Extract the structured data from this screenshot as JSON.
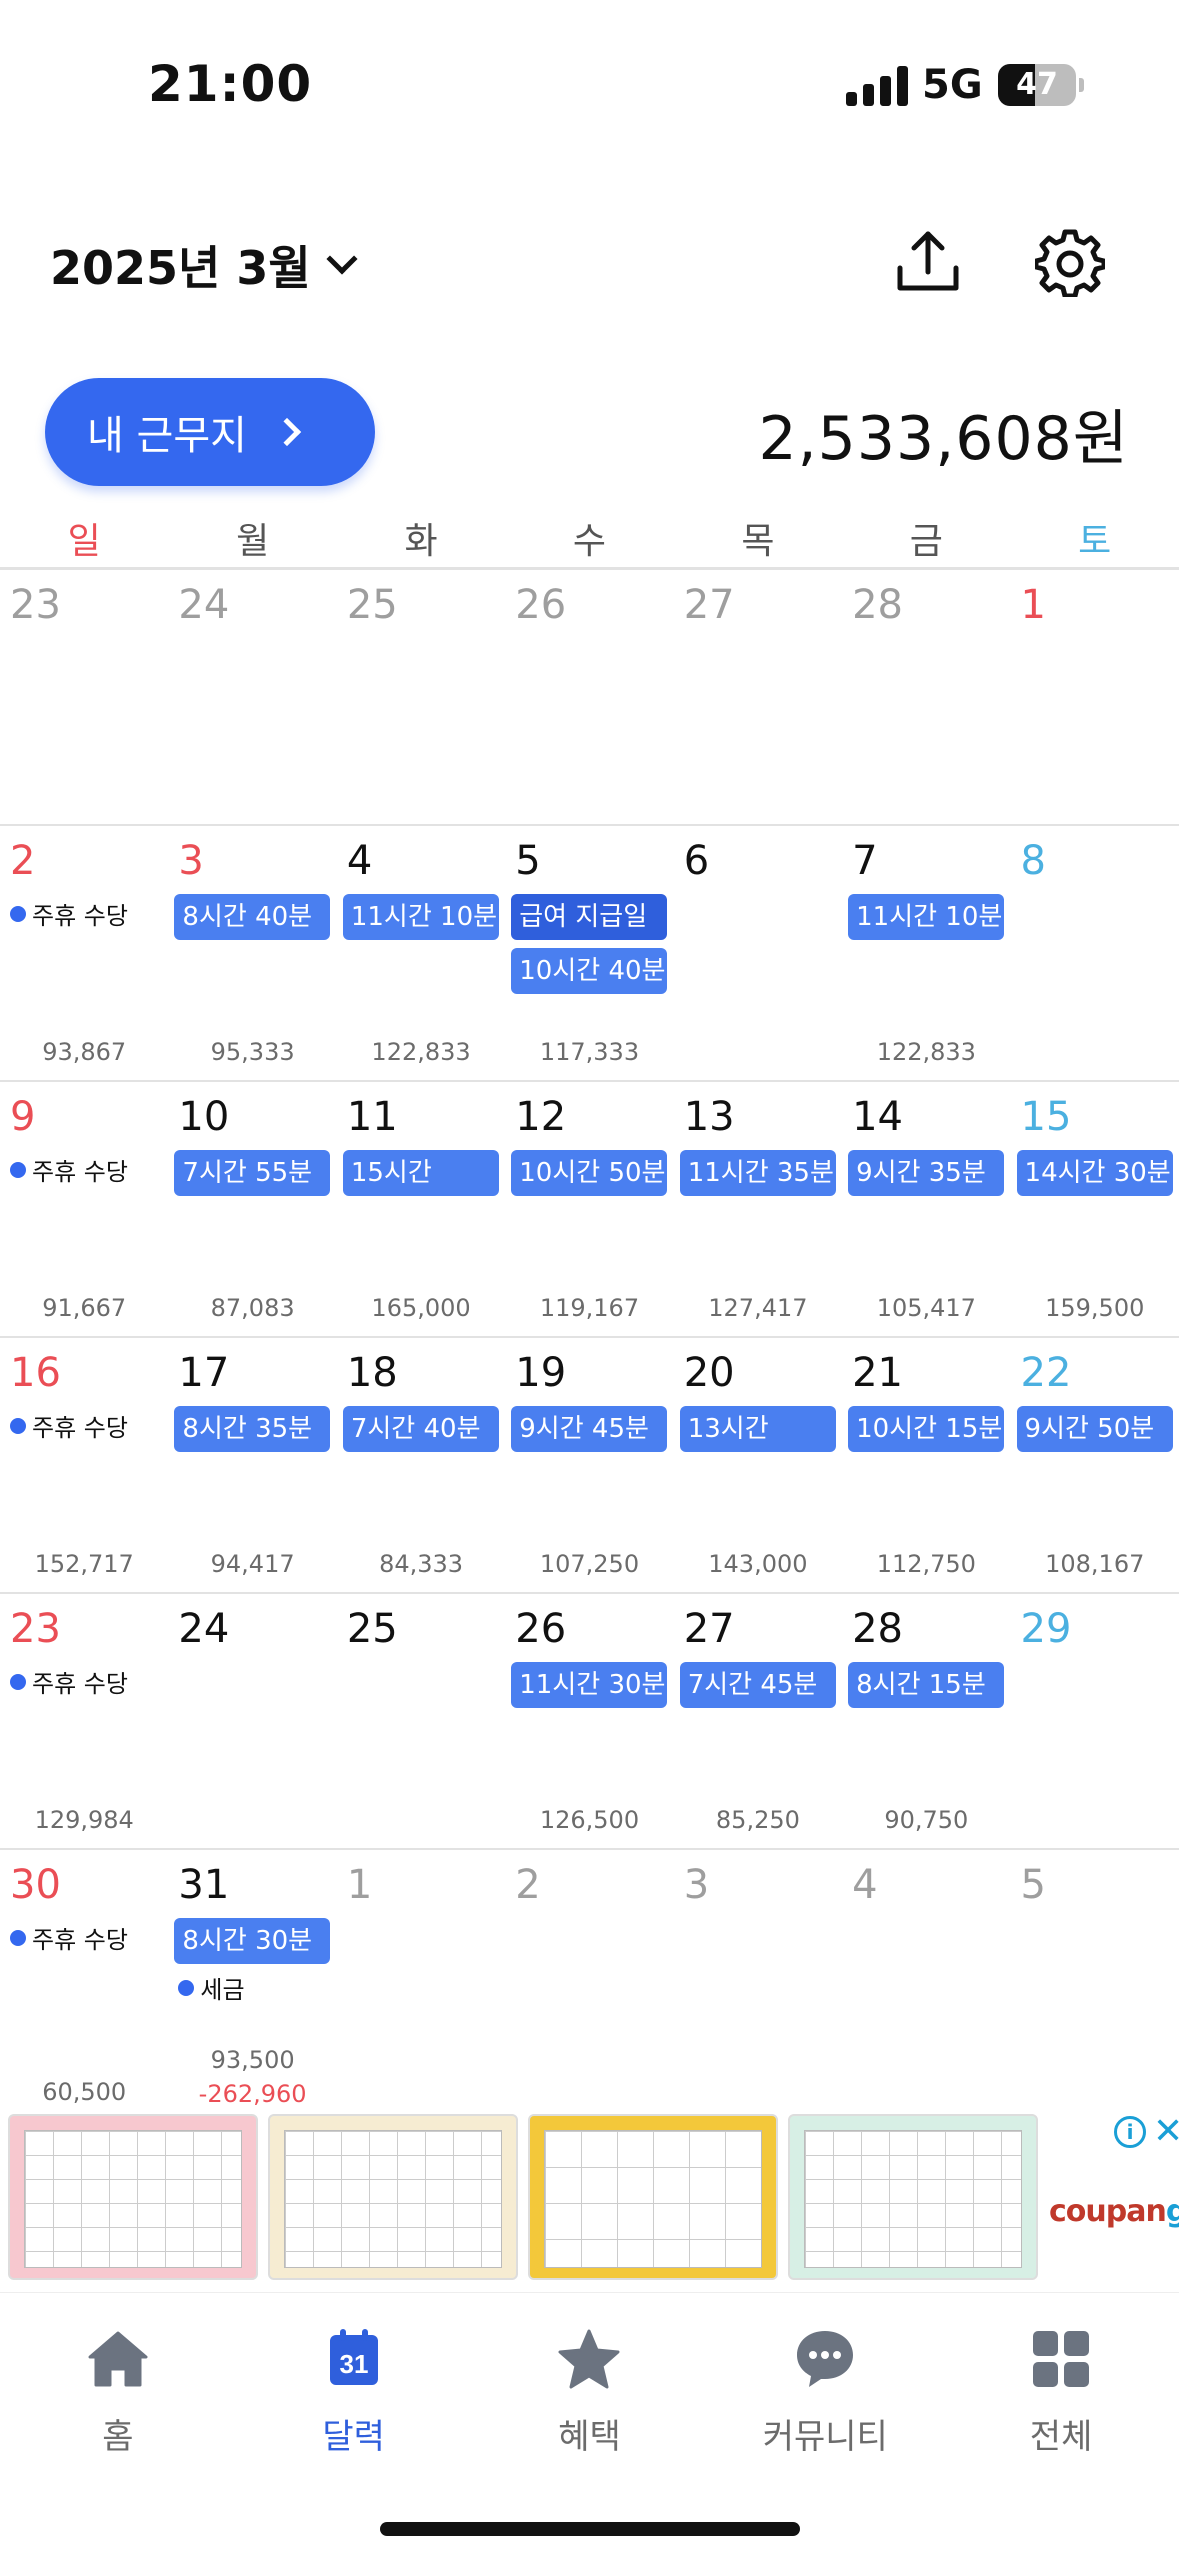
{
  "status": {
    "time": "21:00",
    "network": "5G",
    "battery": "47",
    "battery_level": 0.47
  },
  "header": {
    "title": "2025년 3월",
    "worksite_button": "내 근무지",
    "total": "2,533,608원"
  },
  "weekdays": [
    "일",
    "월",
    "화",
    "수",
    "목",
    "금",
    "토"
  ],
  "weeks": [
    [
      {
        "n": "23",
        "muted": true
      },
      {
        "n": "24",
        "muted": true
      },
      {
        "n": "25",
        "muted": true
      },
      {
        "n": "26",
        "muted": true
      },
      {
        "n": "27",
        "muted": true
      },
      {
        "n": "28",
        "muted": true
      },
      {
        "n": "1",
        "sun": true
      }
    ],
    [
      {
        "n": "2",
        "sun": true,
        "holiday": "주휴 수당",
        "amount": "93,867"
      },
      {
        "n": "3",
        "sun": true,
        "shift": "8시간 40분",
        "amount": "95,333"
      },
      {
        "n": "4",
        "shift": "11시간 10분",
        "amount": "122,833"
      },
      {
        "n": "5",
        "pay": "급여 지급일",
        "shift2": "10시간 40분",
        "amount": "117,333"
      },
      {
        "n": "6"
      },
      {
        "n": "7",
        "shift": "11시간 10분",
        "amount": "122,833"
      },
      {
        "n": "8",
        "sat": true
      }
    ],
    [
      {
        "n": "9",
        "sun": true,
        "holiday": "주휴 수당",
        "amount": "91,667"
      },
      {
        "n": "10",
        "shift": "7시간 55분",
        "amount": "87,083"
      },
      {
        "n": "11",
        "shift": "15시간",
        "amount": "165,000"
      },
      {
        "n": "12",
        "shift": "10시간 50분",
        "amount": "119,167"
      },
      {
        "n": "13",
        "shift": "11시간 35분",
        "amount": "127,417"
      },
      {
        "n": "14",
        "shift": "9시간 35분",
        "amount": "105,417"
      },
      {
        "n": "15",
        "sat": true,
        "shift": "14시간 30분",
        "amount": "159,500"
      }
    ],
    [
      {
        "n": "16",
        "sun": true,
        "holiday": "주휴 수당",
        "amount": "152,717"
      },
      {
        "n": "17",
        "shift": "8시간 35분",
        "amount": "94,417"
      },
      {
        "n": "18",
        "shift": "7시간 40분",
        "amount": "84,333"
      },
      {
        "n": "19",
        "shift": "9시간 45분",
        "amount": "107,250"
      },
      {
        "n": "20",
        "shift": "13시간",
        "amount": "143,000"
      },
      {
        "n": "21",
        "shift": "10시간 15분",
        "amount": "112,750"
      },
      {
        "n": "22",
        "sat": true,
        "shift": "9시간 50분",
        "amount": "108,167"
      }
    ],
    [
      {
        "n": "23",
        "sun": true,
        "holiday": "주휴 수당",
        "amount": "129,984"
      },
      {
        "n": "24"
      },
      {
        "n": "25"
      },
      {
        "n": "26",
        "shift": "11시간 30분",
        "amount": "126,500"
      },
      {
        "n": "27",
        "shift": "7시간 45분",
        "amount": "85,250"
      },
      {
        "n": "28",
        "shift": "8시간 15분",
        "amount": "90,750"
      },
      {
        "n": "29",
        "sat": true
      }
    ],
    [
      {
        "n": "30",
        "sun": true,
        "holiday": "주휴 수당",
        "amount": "60,500"
      },
      {
        "n": "31",
        "shift": "8시간 30분",
        "tax": "세금",
        "amount": "93,500",
        "neg": "-262,960"
      },
      {
        "n": "1",
        "muted": true
      },
      {
        "n": "2",
        "muted": true
      },
      {
        "n": "3",
        "muted": true
      },
      {
        "n": "4",
        "muted": true
      },
      {
        "n": "5",
        "muted": true
      }
    ]
  ],
  "ad": {
    "brand_a": "coupan",
    "brand_b": "g",
    "info": "i",
    "close": "✕"
  },
  "tabs": [
    {
      "label": "홈",
      "icon": "home-icon"
    },
    {
      "label": "달력",
      "icon": "calendar-icon",
      "badge": "31",
      "active": true
    },
    {
      "label": "혜택",
      "icon": "star-icon"
    },
    {
      "label": "커뮤니티",
      "icon": "chat-bubble-icon"
    },
    {
      "label": "전체",
      "icon": "grid-icon"
    }
  ],
  "colors": {
    "accent": "#3468ef",
    "shift": "#4a7ff0",
    "sunday": "#ea4e55",
    "saturday": "#4bb0e0"
  }
}
